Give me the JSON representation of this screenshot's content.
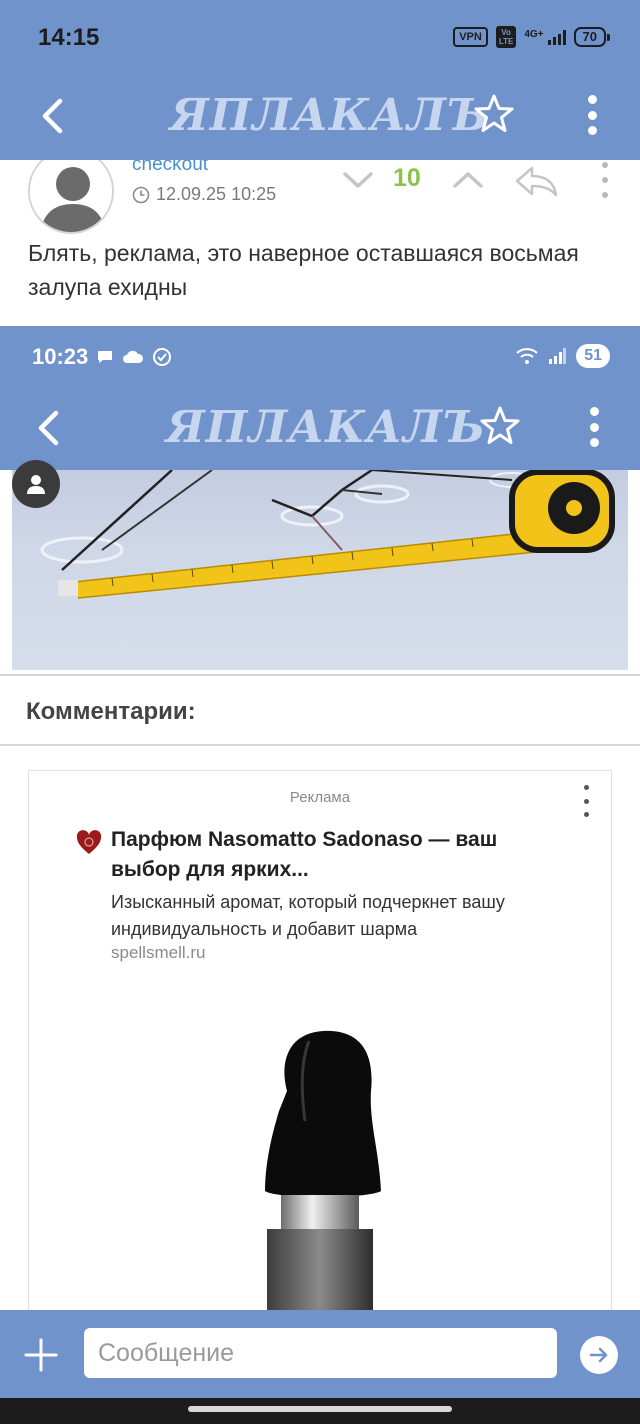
{
  "status_bar": {
    "time": "14:15",
    "vpn": "VPN",
    "volte_top": "Vo",
    "volte_bottom": "LTE",
    "network": "4G+",
    "battery": "70"
  },
  "header": {
    "logo": "ЯПЛАКАЛЪ",
    "icons": [
      "back-icon",
      "star-icon",
      "more-vertical-icon"
    ]
  },
  "comment": {
    "author": "checkout",
    "time": "12.09.25 10:25",
    "votes": "10",
    "text": "Блять, реклама, это наверное оставшаяся восьмая залупа ехидны",
    "icons": [
      "clock-icon",
      "vote-down-icon",
      "vote-up-icon",
      "reply-icon",
      "more-vertical-icon"
    ]
  },
  "embedded": {
    "status_time": "10:23",
    "battery": "51",
    "logo": "ЯПЛАКАЛЪ",
    "comments_title": "Комментарии:",
    "ad": {
      "label": "Реклама",
      "title": "Парфюм Nasomatto Sadonaso — ваш выбор для ярких...",
      "description": "Изысканный аромат, который подчеркнет вашу индивидуальность и добавит шарма",
      "domain": "spellsmell.ru"
    }
  },
  "input_bar": {
    "placeholder": "Сообщение",
    "icons": [
      "plus-icon",
      "send-icon"
    ]
  },
  "colors": {
    "header_bg": "#7193cb",
    "logo": "#c7d6ef",
    "author_link": "#4a8fd1",
    "votes_positive": "#8bc34a"
  }
}
